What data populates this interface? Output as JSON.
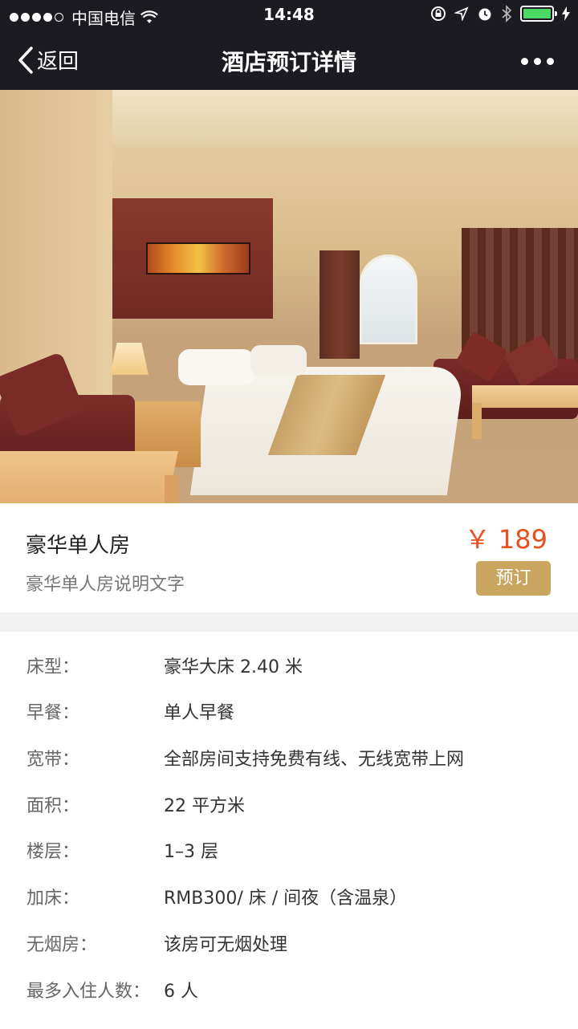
{
  "status_bar": {
    "carrier": "中国电信",
    "time": "14:48",
    "battery_level": 1.0
  },
  "nav": {
    "back_label": "返回",
    "title": "酒店预订详情",
    "more_icon": "more-icon"
  },
  "room": {
    "name": "豪华单人房",
    "description": "豪华单人房说明文字",
    "price": "￥ 189",
    "book_label": "预订"
  },
  "details": [
    {
      "label": "床型：",
      "value": "豪华大床 2.40 米"
    },
    {
      "label": "早餐：",
      "value": "单人早餐"
    },
    {
      "label": "宽带：",
      "value": "全部房间支持免费有线、无线宽带上网"
    },
    {
      "label": "面积：",
      "value": "22 平方米"
    },
    {
      "label": "楼层：",
      "value": "1–3 层"
    },
    {
      "label": "加床：",
      "value": "RMB300/ 床 / 间夜（含温泉）"
    },
    {
      "label": "无烟房：",
      "value": "该房可无烟处理"
    },
    {
      "label": "最多入住人数：",
      "value": "6 人"
    }
  ],
  "colors": {
    "nav_background": "#1c1b21",
    "price": "#e8501d",
    "book_button": "#c9a560",
    "battery": "#4cd964"
  }
}
